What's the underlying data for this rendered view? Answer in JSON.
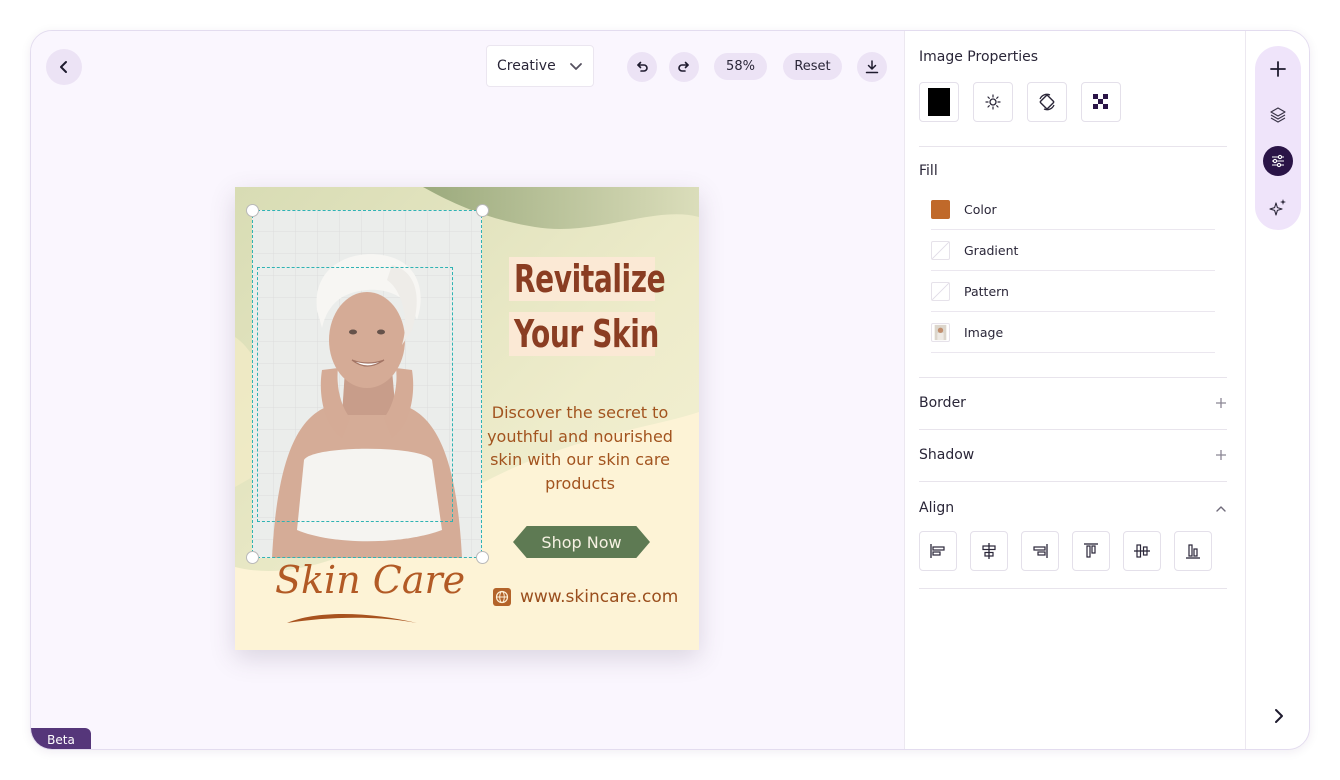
{
  "toolbar": {
    "template_select": "Creative",
    "zoom": "58%",
    "reset_label": "Reset"
  },
  "artboard": {
    "headline_line1": "Revitalize",
    "headline_line2": "Your Skin",
    "description": "Discover the secret to youthful and nourished skin with our skin care products",
    "cta_label": "Shop Now",
    "website": "www.skincare.com",
    "logo_text": "Skin Care"
  },
  "beta_label": "Beta",
  "properties": {
    "title": "Image Properties",
    "fill": {
      "heading": "Fill",
      "options": [
        {
          "label": "Color",
          "swatch": "#c0692a"
        },
        {
          "label": "Gradient"
        },
        {
          "label": "Pattern"
        },
        {
          "label": "Image"
        }
      ]
    },
    "border_label": "Border",
    "shadow_label": "Shadow",
    "align_label": "Align"
  },
  "colors": {
    "accent": "#2a1447",
    "canvas_bg": "#faf6fe",
    "shop_button": "#5e7a53",
    "headline": "#8a3d22"
  },
  "icons": {
    "rail": [
      "plus-icon",
      "layers-icon",
      "sliders-icon",
      "sparkles-icon"
    ],
    "props_tools": [
      "color-swatch-icon",
      "brightness-icon",
      "rotate-icon",
      "transparency-icon"
    ],
    "align": [
      "align-left-icon",
      "align-center-h-icon",
      "align-right-icon",
      "align-top-icon",
      "align-middle-v-icon",
      "align-bottom-icon"
    ]
  }
}
